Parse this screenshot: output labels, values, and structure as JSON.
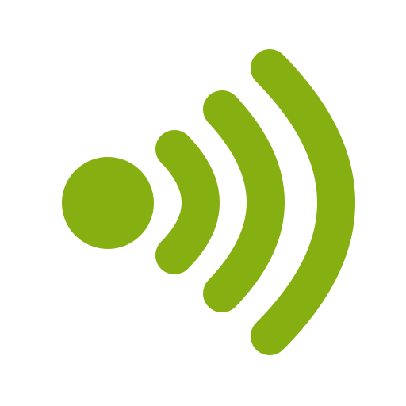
{
  "icon": {
    "name": "wireless-signal-icon",
    "color": "#86b011",
    "background": "#ffffff",
    "signal_arcs": 3
  }
}
